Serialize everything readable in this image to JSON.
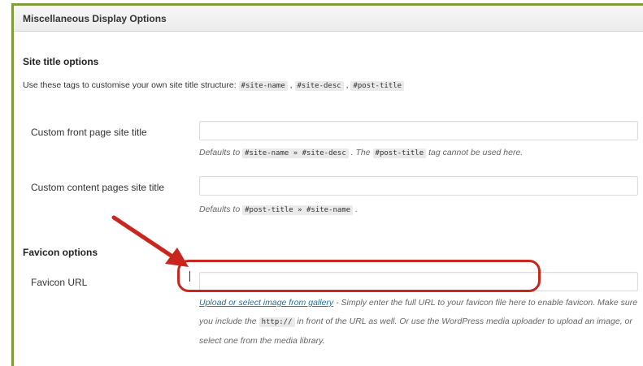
{
  "panel": {
    "title": "Miscellaneous Display Options"
  },
  "site_title": {
    "heading": "Site title options",
    "desc_prefix": "Use these tags to customise your own site title structure:",
    "tag_site_name": "#site-name",
    "tag_site_desc": "#site-desc",
    "tag_post_title": "#post-title",
    "sep": ","
  },
  "front_page": {
    "label": "Custom front page site title",
    "value": "",
    "help_prefix": "Defaults to",
    "help_code": "#site-name » #site-desc",
    "help_mid": ". The",
    "help_code2": "#post-title",
    "help_suffix": "tag cannot be used here."
  },
  "content_pages": {
    "label": "Custom content pages site title",
    "value": "",
    "help_prefix": "Defaults to",
    "help_code": "#post-title » #site-name",
    "help_suffix": "."
  },
  "favicon": {
    "heading": "Favicon options",
    "label": "Favicon URL",
    "value": "",
    "link_text": "Upload or select image from gallery",
    "help_text1": " - Simply enter the full URL to your favicon file here to enable favicon. Make sure you include the",
    "help_code": "http://",
    "help_text2": "in front of the URL as well. Or use the WordPress media uploader to upload an image, or select one from the media library."
  },
  "annotation": {
    "arrow_color": "#c9261d",
    "highlight_color": "#c9261d"
  }
}
